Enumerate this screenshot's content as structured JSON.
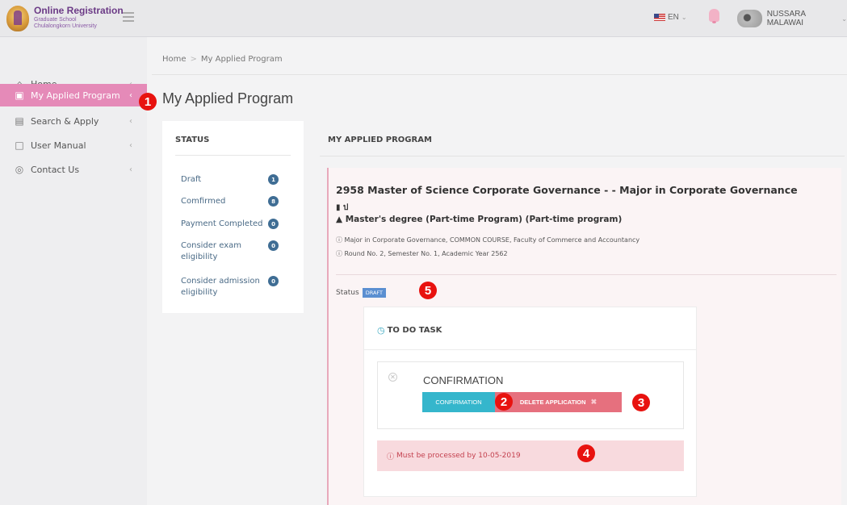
{
  "header": {
    "brand_title": "Online Registration",
    "brand_line1": "Graduate School",
    "brand_line2": "Chulalongkorn University",
    "lang": "EN",
    "user_name": "NUSSARA MALAWAI"
  },
  "sidebar": {
    "items": [
      {
        "label": "Home",
        "icon": "home-icon"
      },
      {
        "label": "My Applied Program",
        "icon": "briefcase-icon"
      },
      {
        "label": "Search & Apply",
        "icon": "book-icon"
      },
      {
        "label": "User Manual",
        "icon": "document-icon"
      },
      {
        "label": "Contact Us",
        "icon": "location-icon"
      }
    ],
    "active_index": 1
  },
  "breadcrumb": {
    "home": "Home",
    "separator": ">",
    "current": "My Applied Program"
  },
  "page_title": "My Applied Program",
  "status_panel": {
    "heading": "STATUS",
    "items": [
      {
        "label": "Draft",
        "count": "1"
      },
      {
        "label": "Comfirmed",
        "count": "8"
      },
      {
        "label": "Payment Completed",
        "count": "0"
      },
      {
        "label": "Consider exam eligibility",
        "count": "0"
      },
      {
        "label": "Consider admission eligibility",
        "count": "0"
      }
    ]
  },
  "main": {
    "heading": "MY APPLIED PROGRAM",
    "program": {
      "title": "2958 Master of Science Corporate Governance - - Major in Corporate Governance",
      "code_line": "ป",
      "degree": "Master's degree (Part-time Program) (Part-time program)",
      "info1": "Major in Corporate Governance, COMMON COURSE, Faculty of Commerce and Accountancy",
      "info2": "Round No. 2, Semester No. 1, Academic Year 2562",
      "status_label": "Status",
      "status_badge": "DRAFT"
    },
    "todo": {
      "heading": "TO DO TASK",
      "task_title": "CONFIRMATION",
      "confirm_button": "CONFIRMATION",
      "delete_button": "DELETE APPLICATION",
      "deadline": "Must be processed by 10-05-2019"
    }
  },
  "markers": [
    "1",
    "2",
    "3",
    "4",
    "5"
  ],
  "colors": {
    "sidebar_active": "#e58ab8",
    "confirm_button": "#35b6cc",
    "delete_button": "#e6707e",
    "deadline_bg": "#f8dade",
    "marker": "#e8120f",
    "badge": "#3f6d94",
    "draft_badge": "#5b8fd1"
  }
}
